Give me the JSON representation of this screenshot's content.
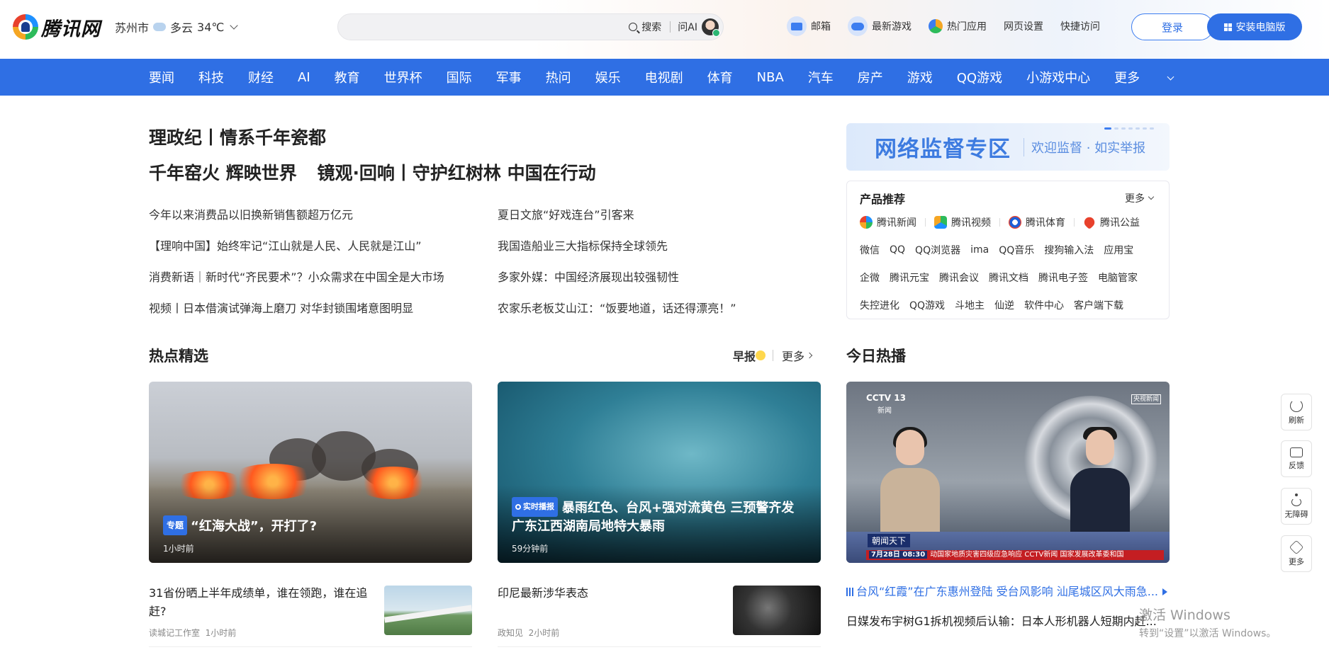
{
  "brand": {
    "name": "腾讯网"
  },
  "weather": {
    "city": "苏州市",
    "condition": "多云",
    "temp": "34℃"
  },
  "search": {
    "placeholder": "",
    "button": "搜索",
    "ask_ai": "问AI"
  },
  "top_links": [
    {
      "label": "邮箱",
      "icon": "mail-icon"
    },
    {
      "label": "最新游戏",
      "icon": "gamepad-icon"
    },
    {
      "label": "热门应用",
      "icon": "apps-icon"
    },
    {
      "label": "网页设置"
    },
    {
      "label": "快捷访问"
    }
  ],
  "auth": {
    "login": "登录",
    "install": "安装电脑版"
  },
  "nav": [
    "要闻",
    "科技",
    "财经",
    "AI",
    "教育",
    "世界杯",
    "国际",
    "军事",
    "热问",
    "娱乐",
    "电视剧",
    "体育",
    "NBA",
    "汽车",
    "房产",
    "游戏",
    "QQ游戏",
    "小游戏中心",
    "更多"
  ],
  "headlines": {
    "top": "理政纪丨情系千年瓷都",
    "second": [
      "千年窑火 辉映世界",
      "镜观·回响丨守护红树林 中国在行动"
    ]
  },
  "news_list": [
    "今年以来消费品以旧换新销售额超万亿元",
    "夏日文旅“好戏连台”引客来",
    "【理响中国】始终牢记“江山就是人民、人民就是江山”",
    "我国造船业三大指标保持全球领先",
    "消费新语｜新时代“齐民要术”？小众需求在中国全是大市场",
    "多家外媒：中国经济展现出较强韧性",
    "视频丨日本借演试弹海上磨刀 对华封锁围堵意图明显",
    "农家乐老板艾山江：“饭要地道，话还得漂亮！”"
  ],
  "banner": {
    "title": "网络监督专区",
    "subtitle": "欢迎监督 · 如实举报"
  },
  "products": {
    "title": "产品推荐",
    "more": "更多",
    "featured": [
      "腾讯新闻",
      "腾讯视频",
      "腾讯体育",
      "腾讯公益"
    ],
    "row1": [
      "微信",
      "QQ",
      "QQ浏览器",
      "ima",
      "QQ音乐",
      "搜狗输入法",
      "应用宝"
    ],
    "row2": [
      "企微",
      "腾讯元宝",
      "腾讯会议",
      "腾讯文档",
      "腾讯电子签",
      "电脑管家"
    ],
    "row3": [
      "失控进化",
      "QQ游戏",
      "斗地主",
      "仙逆",
      "软件中心",
      "客户端下载"
    ]
  },
  "sections": {
    "hot_picks": "热点精选",
    "morning": "早报",
    "more": "更多",
    "today_hot": "今日热播"
  },
  "cards": [
    {
      "tag": "专题",
      "title": "“红海大战”，开打了?",
      "time": "1小时前"
    },
    {
      "tag": "实时播报",
      "title_line1": "暴雨红色、台风+强对流黄色 三预警齐发",
      "title_line2": "广东江西湖南局地特大暴雨",
      "time": "59分钟前"
    },
    {
      "channel": "CCTV 13",
      "channel_sub": "新闻",
      "badge": "央视新闻",
      "program": "朝闻天下",
      "ticker_time": "7月28日 08:30",
      "ticker": "动国家地质灾害四级应急响应 CCTV新闻 国家发展改革委和国"
    }
  ],
  "stories": [
    {
      "title": "31省份晒上半年成绩单，谁在领跑，谁在追赶?",
      "source": "读城记工作室",
      "time": "1小时前"
    },
    {
      "title": "印尼最新涉华表态",
      "source": "政知见",
      "time": "2小时前"
    }
  ],
  "hot_list": [
    "台风“红霞”在广东惠州登陆 受台风影响 汕尾城区风大雨急...",
    "日媒发布宇树G1拆机视频后认输：日本人形机器人短期内赶..."
  ],
  "side_tools": [
    "刷新",
    "反馈",
    "无障碍",
    "更多"
  ],
  "watermark": {
    "line1": "激活 Windows",
    "line2": "转到“设置”以激活 Windows。"
  }
}
